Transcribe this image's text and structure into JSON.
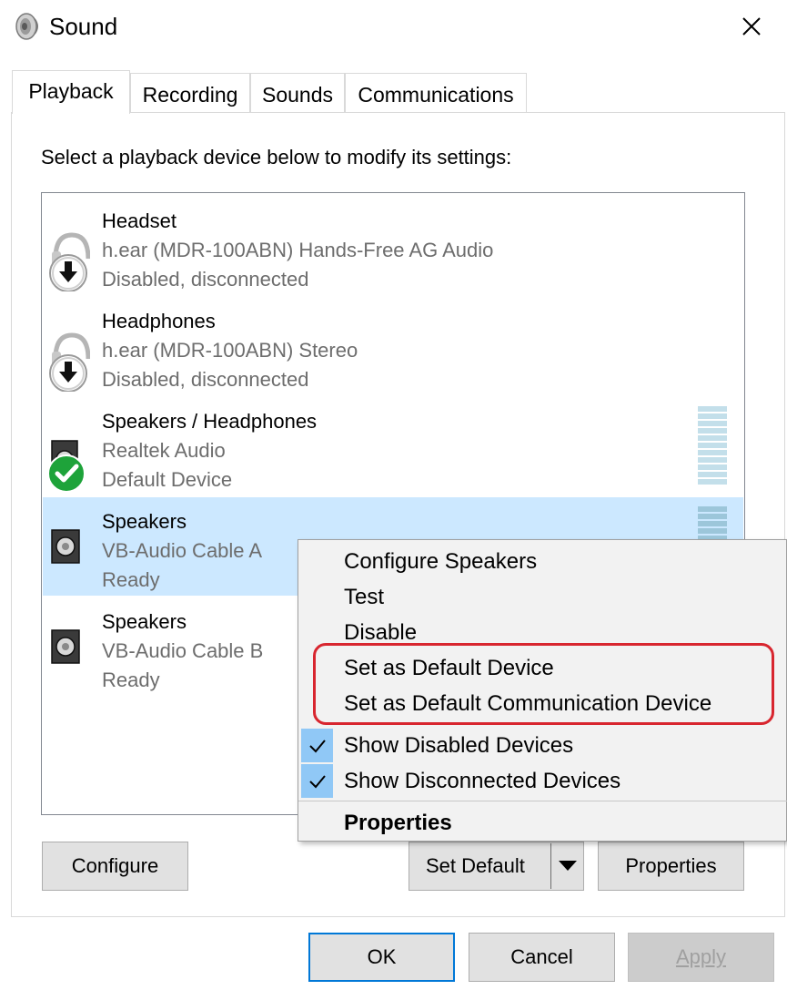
{
  "window": {
    "title": "Sound",
    "icon": "speaker-icon",
    "close_icon": "close-icon"
  },
  "tabs": [
    {
      "label": "Playback",
      "active": true
    },
    {
      "label": "Recording",
      "active": false
    },
    {
      "label": "Sounds",
      "active": false
    },
    {
      "label": "Communications",
      "active": false
    }
  ],
  "instructions": "Select a playback device below to modify its settings:",
  "devices": [
    {
      "name": "Headset",
      "description": "h.ear (MDR-100ABN) Hands-Free AG Audio",
      "status": "Disabled, disconnected",
      "icon": "headset-disabled-icon"
    },
    {
      "name": "Headphones",
      "description": "h.ear (MDR-100ABN) Stereo",
      "status": "Disabled, disconnected",
      "icon": "headphones-disabled-icon"
    },
    {
      "name": "Speakers / Headphones",
      "description": "Realtek Audio",
      "status": "Default Device",
      "icon": "speaker-default-icon"
    },
    {
      "name": "Speakers",
      "description": "VB-Audio Cable A",
      "status": "Ready",
      "icon": "speaker-icon",
      "selected": true
    },
    {
      "name": "Speakers",
      "description": "VB-Audio Cable B",
      "status": "Ready",
      "icon": "speaker-icon"
    }
  ],
  "context_menu": {
    "items": [
      {
        "label": "Configure Speakers"
      },
      {
        "label": "Test"
      },
      {
        "label": "Disable"
      },
      {
        "label": "Set as Default Device"
      },
      {
        "label": "Set as Default Communication Device"
      },
      {
        "label": "Show Disabled Devices",
        "checked": true
      },
      {
        "label": "Show Disconnected Devices",
        "checked": true
      },
      {
        "label": "Properties",
        "bold": true
      }
    ]
  },
  "buttons": {
    "configure": "Configure",
    "set_default": "Set Default",
    "properties": "Properties",
    "ok": "OK",
    "cancel": "Cancel",
    "apply": "Apply"
  },
  "colors": {
    "selection": "#cce8ff",
    "accent": "#0078d7",
    "highlight_ring": "#d8262f",
    "check_bg": "#90c8f6",
    "default_check": "#1ea33a"
  }
}
